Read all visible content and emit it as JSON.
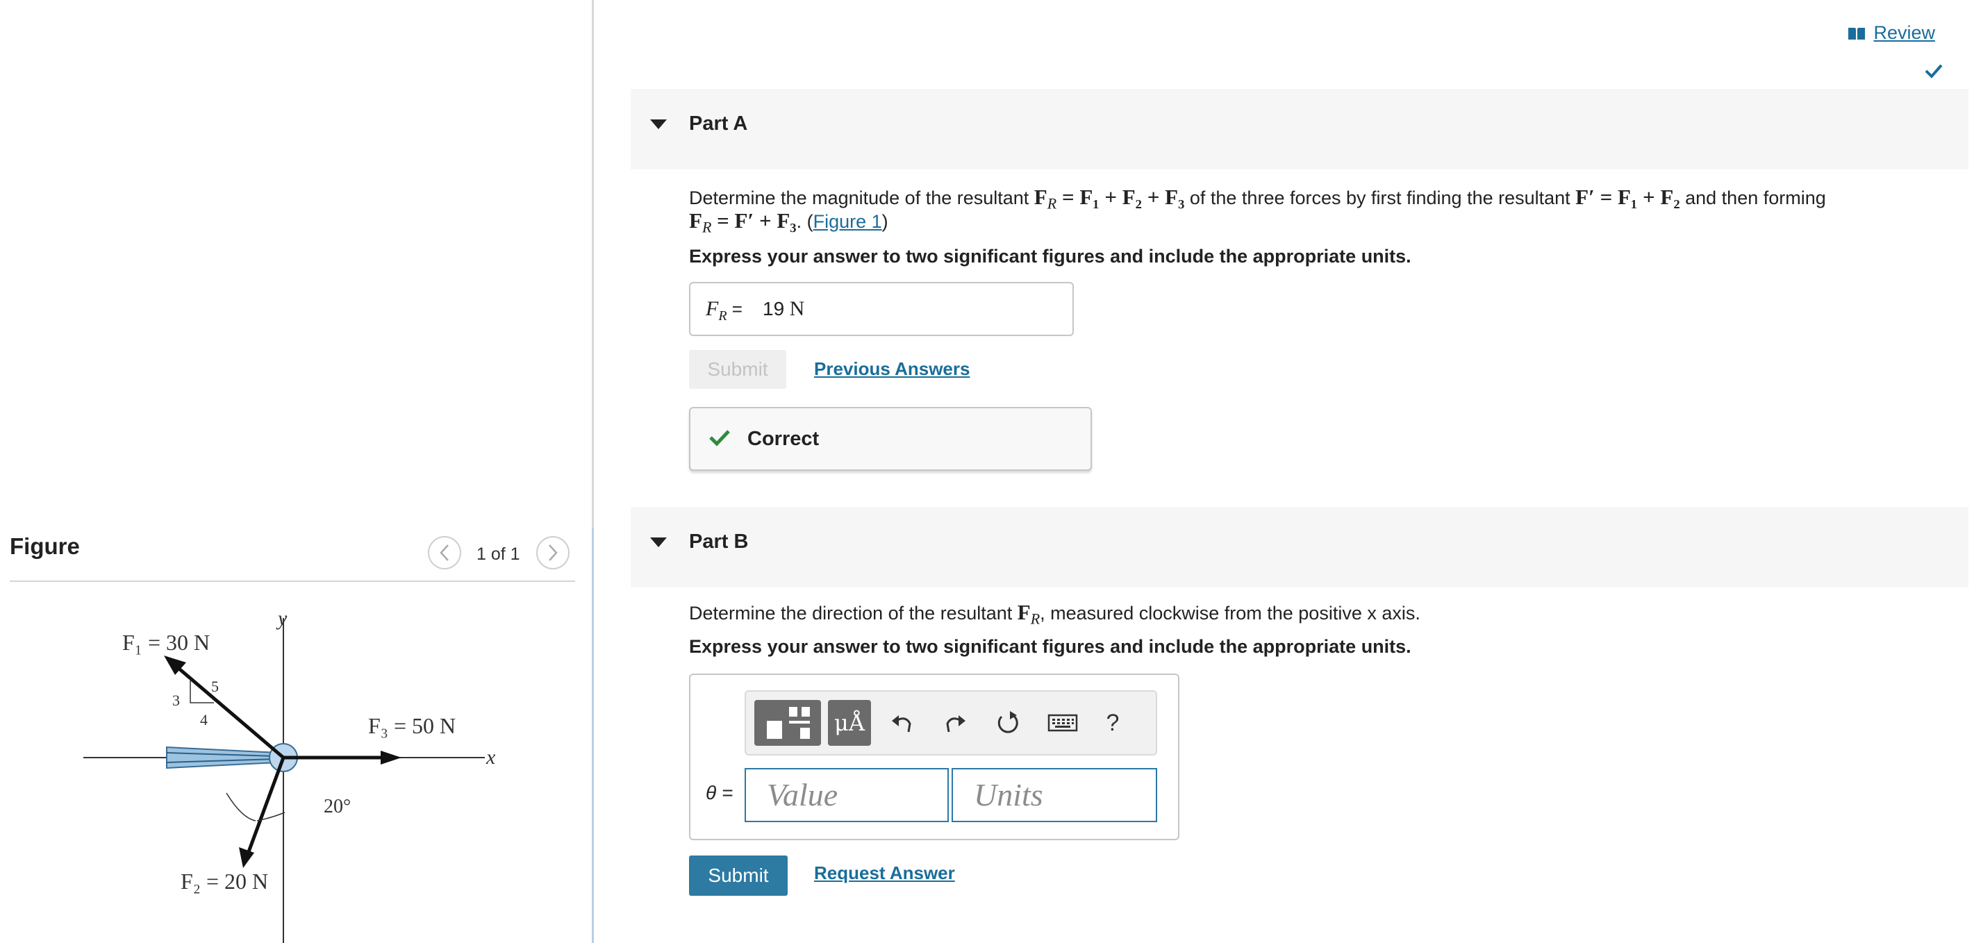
{
  "header": {
    "review_label": "Review",
    "review_icon": "book-icon"
  },
  "figure_panel": {
    "title": "Figure",
    "counter": "1 of 1",
    "prev_icon": "chevron-left-icon",
    "next_icon": "chevron-right-icon",
    "labels": {
      "f1": "F₁ = 30 N",
      "f2": "F₂ = 20 N",
      "f3": "F₃ = 50 N",
      "y_axis": "y",
      "x_axis": "x",
      "slope_hyp": "5",
      "slope_rise": "3",
      "slope_run": "4",
      "angle": "20°"
    }
  },
  "part_a": {
    "title": "Part A",
    "completed": true,
    "q_prefix": "Determine the magnitude of the resultant ",
    "q_fr": "F",
    "q_fr_sub": "R",
    "q_eq1": " = F₁ + F₂ + F₃",
    "q_mid": " of the three forces by first finding the resultant ",
    "q_fprime": "F′ = F₁ + F₂",
    "q_then": " and then forming",
    "q_line2_fr": "F",
    "q_line2_sub": "R",
    "q_line2_eq": " = F′ + F₃",
    "q_line2_dot": ". (",
    "figure_link": "Figure 1",
    "q_line2_close": ")",
    "instruction": "Express your answer to two significant figures and include the appropriate units.",
    "answer_label": "F",
    "answer_label_sub": "R",
    "answer_equals": " = ",
    "answer_number": "19",
    "answer_unit": " N",
    "submit_label": "Submit",
    "previous_answers_label": "Previous Answers",
    "feedback": "Correct"
  },
  "part_b": {
    "title": "Part B",
    "q_prefix": "Determine the direction of the resultant ",
    "q_fr": "F",
    "q_fr_sub": "R",
    "q_suffix": ", measured clockwise from the positive x axis.",
    "instruction": "Express your answer to two significant figures and include the appropriate units.",
    "toolbar": {
      "units_symbol": "μÅ",
      "help": "?"
    },
    "theta_label": "θ =",
    "value_placeholder": "Value",
    "units_placeholder": "Units",
    "submit_label": "Submit",
    "request_answer_label": "Request Answer"
  },
  "colors": {
    "link": "#1a6d9a",
    "submit_active": "#2d7aa2",
    "correct_green": "#2e8b3d",
    "check_blue": "#1a6d9a"
  }
}
